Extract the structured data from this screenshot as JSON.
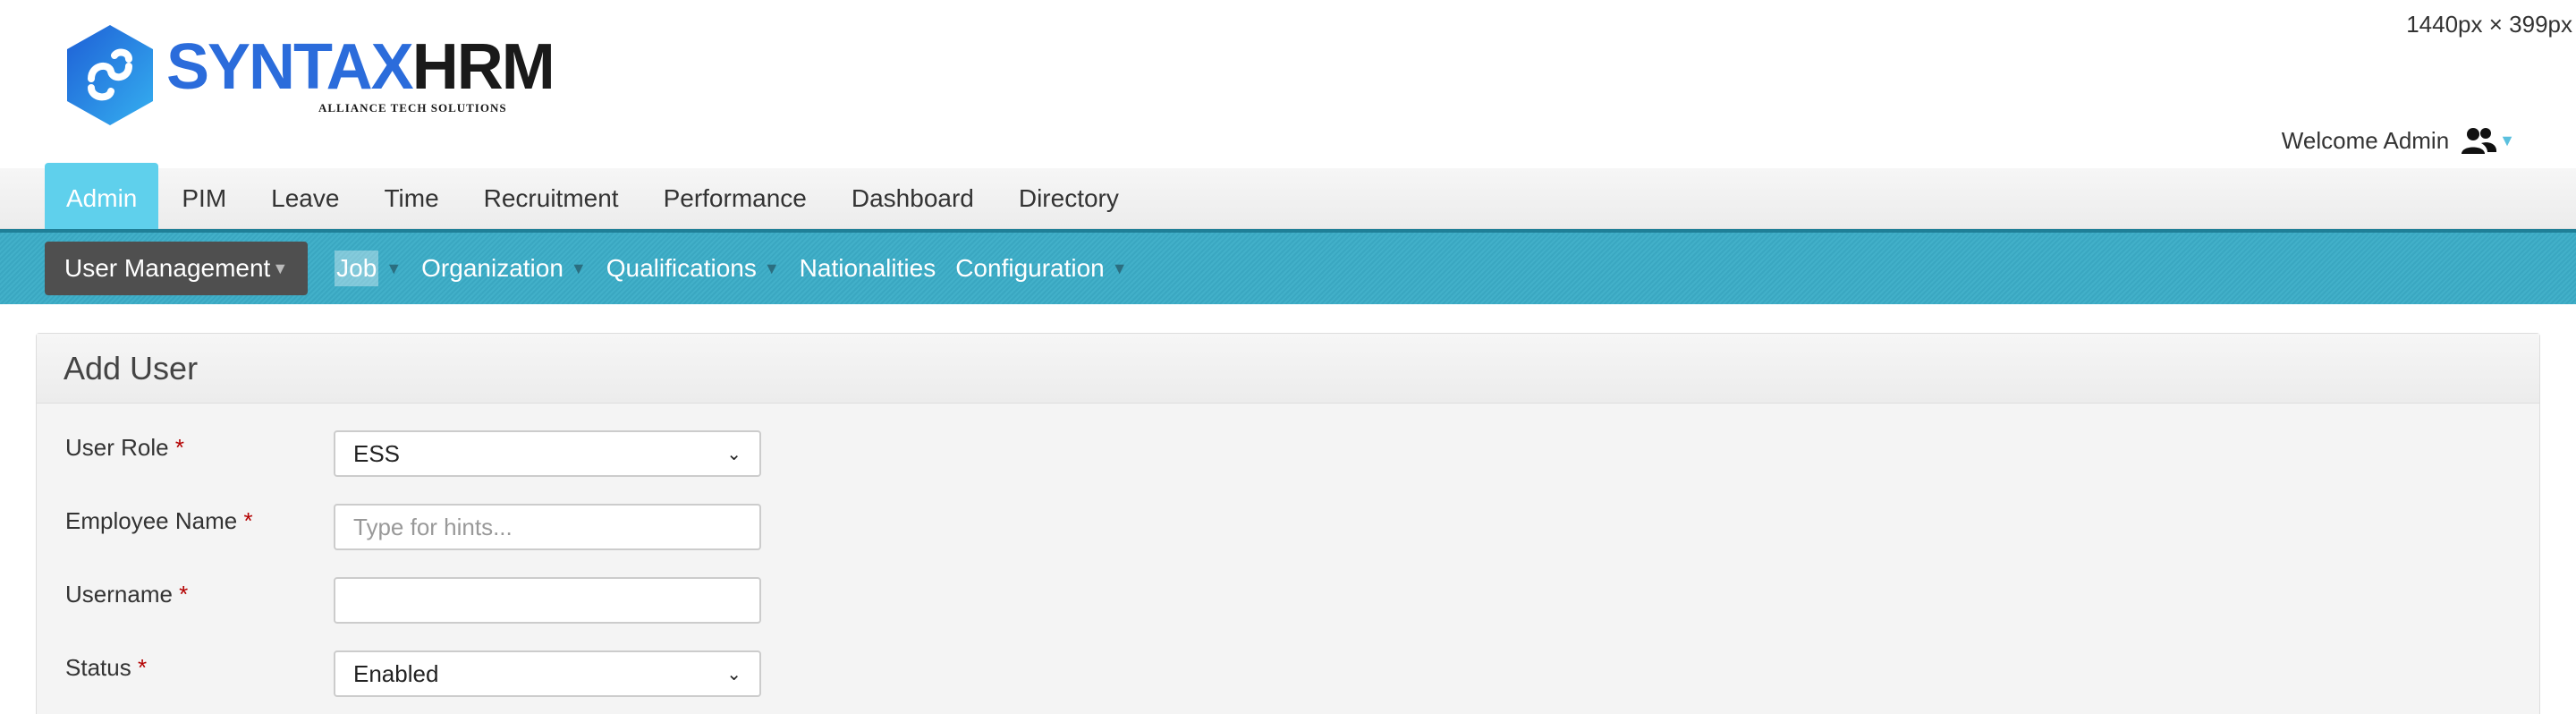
{
  "viewport_label": "1440px × 399px",
  "brand": {
    "name_part1": "SYNTAX",
    "name_part2": "HRM",
    "tagline": "ALLIANCE TECH SOLUTIONS"
  },
  "header": {
    "welcome": "Welcome Admin"
  },
  "main_menu": [
    {
      "label": "Admin",
      "active": true
    },
    {
      "label": "PIM"
    },
    {
      "label": "Leave"
    },
    {
      "label": "Time"
    },
    {
      "label": "Recruitment"
    },
    {
      "label": "Performance"
    },
    {
      "label": "Dashboard"
    },
    {
      "label": "Directory"
    }
  ],
  "sub_menu": [
    {
      "label": "User Management",
      "active": true
    },
    {
      "label": "Job"
    },
    {
      "label": "Organization"
    },
    {
      "label": "Qualifications"
    },
    {
      "label": "Nationalities"
    },
    {
      "label": "Configuration"
    }
  ],
  "form": {
    "title": "Add User",
    "required_marker": "*",
    "user_role": {
      "label": "User Role",
      "value": "ESS"
    },
    "employee_name": {
      "label": "Employee Name",
      "value": "",
      "placeholder": "Type for hints..."
    },
    "username": {
      "label": "Username",
      "value": ""
    },
    "status": {
      "label": "Status",
      "value": "Enabled"
    }
  },
  "colors": {
    "accent": "#5fd0ec",
    "submenu": "#3aa7c1",
    "active_submenu": "#4f4f4f",
    "brand_blue": "#2b6cdb",
    "required": "#b30000"
  }
}
